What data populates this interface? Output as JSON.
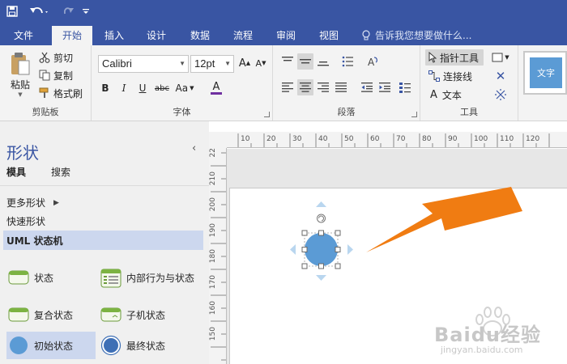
{
  "quick_access": {
    "save_icon": "save-icon",
    "undo_icon": "undo-icon",
    "redo_icon": "redo-icon",
    "customize_icon": "customize-icon"
  },
  "tabs": [
    {
      "label": "文件"
    },
    {
      "label": "开始",
      "active": true
    },
    {
      "label": "插入"
    },
    {
      "label": "设计"
    },
    {
      "label": "数据"
    },
    {
      "label": "流程"
    },
    {
      "label": "审阅"
    },
    {
      "label": "视图"
    }
  ],
  "tell_me": {
    "placeholder": "告诉我您想要做什么..."
  },
  "ribbon": {
    "clipboard": {
      "label": "剪贴板",
      "paste": "粘贴",
      "cut": "剪切",
      "copy": "复制",
      "format_painter": "格式刷"
    },
    "font": {
      "label": "字体",
      "family": "Calibri",
      "size": "12pt",
      "bold": "B",
      "italic": "I",
      "underline": "U",
      "strike": "abc",
      "case": "Aa",
      "color": "A"
    },
    "paragraph": {
      "label": "段落"
    },
    "tools": {
      "label": "工具",
      "pointer": "指针工具",
      "connector": "连接线",
      "text": "文本",
      "text_glyph": "A"
    },
    "shape_styles": {
      "sample": "文字"
    }
  },
  "shapes_pane": {
    "title": "形状",
    "tabs": [
      {
        "label": "模具",
        "active": true
      },
      {
        "label": "搜索"
      }
    ],
    "stencils": [
      {
        "label": "更多形状"
      },
      {
        "label": "快速形状"
      },
      {
        "label": "UML 状态机",
        "selected": true
      }
    ],
    "shapes": [
      {
        "label": "状态",
        "icon": "state-icon"
      },
      {
        "label": "内部行为与状态",
        "icon": "internal-behavior-icon"
      },
      {
        "label": "复合状态",
        "icon": "composite-state-icon"
      },
      {
        "label": "子机状态",
        "icon": "submachine-state-icon"
      },
      {
        "label": "初始状态",
        "icon": "initial-state-icon",
        "selected": true
      },
      {
        "label": "最终状态",
        "icon": "final-state-icon"
      }
    ]
  },
  "rulers": {
    "horizontal": [
      "10",
      "20",
      "30",
      "40",
      "50",
      "60",
      "70",
      "80",
      "90",
      "100",
      "110",
      "120"
    ],
    "vertical": [
      "210",
      "200",
      "190",
      "180",
      "170",
      "160",
      "150"
    ],
    "vertical_partial": "22"
  },
  "colors": {
    "ribbon_blue": "#3955a3",
    "shape_fill": "#5b9bd5",
    "arrow": "#f07c12",
    "selected_bg": "#ccd7ee"
  },
  "watermark": {
    "text": "Baidu经验",
    "sub": "jingyan.baidu.com"
  }
}
